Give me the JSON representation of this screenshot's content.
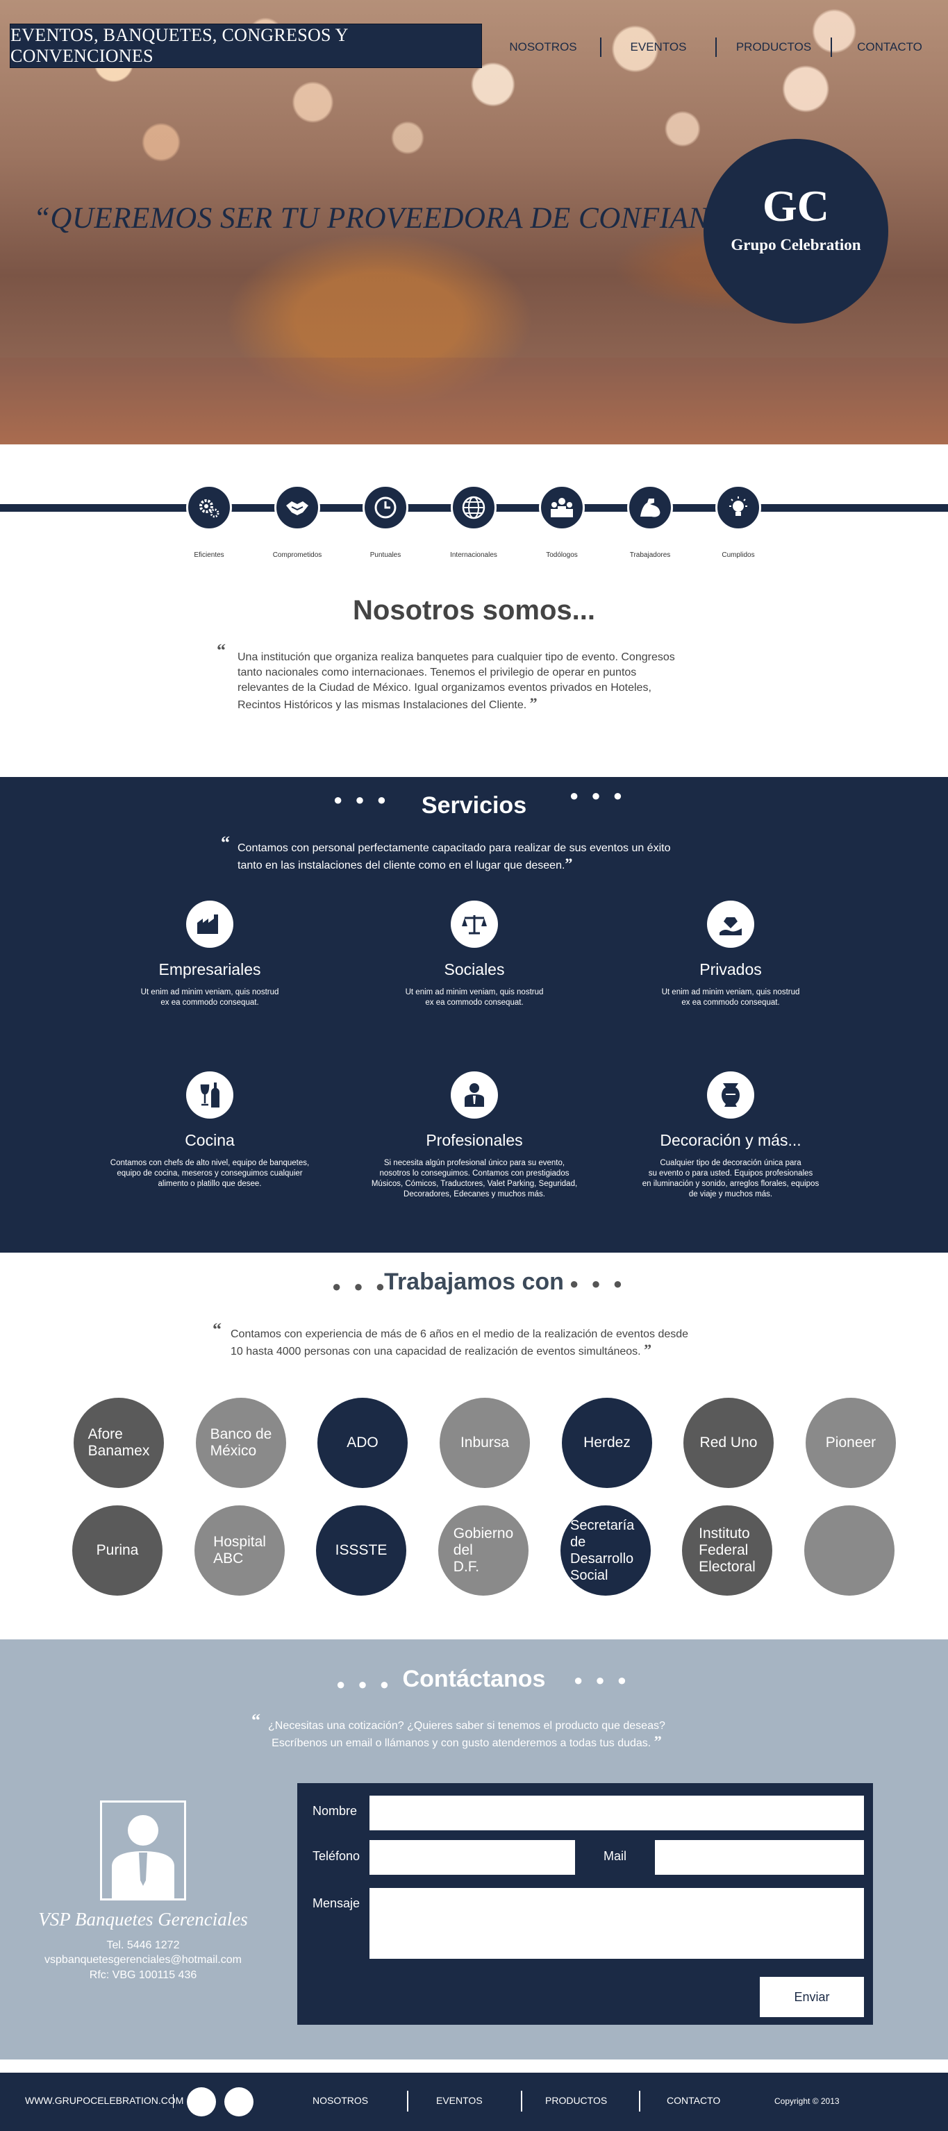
{
  "header": {
    "title": "EVENTOS, BANQUETES, CONGRESOS Y CONVENCIONES",
    "nav": [
      "NOSOTROS",
      "EVENTOS",
      "PRODUCTOS",
      "CONTACTO"
    ],
    "slogan": "“QUEREMOS SER TU PROVEEDORA DE CONFIANZA.”",
    "logo_letters": "GC",
    "logo_name": "Grupo Celebration"
  },
  "values": [
    {
      "label": "Eficientes",
      "icon": "gears-icon"
    },
    {
      "label": "Comprometidos",
      "icon": "handshake-icon"
    },
    {
      "label": "Puntuales",
      "icon": "clock-icon"
    },
    {
      "label": "Internacionales",
      "icon": "globe-icon"
    },
    {
      "label": "Todólogos",
      "icon": "team-icon"
    },
    {
      "label": "Trabajadores",
      "icon": "muscle-arm-icon"
    },
    {
      "label": "Cumplidos",
      "icon": "lightbulb-icon"
    }
  ],
  "nosotros": {
    "title": "Nosotros somos...",
    "lines": [
      "Una institución que organiza realiza banquetes para cualquier tipo de evento. Congresos",
      "tanto nacionales como internacionaes. Tenemos el privilegio de operar en puntos",
      "relevantes de la Ciudad de México. Igual organizamos eventos privados en Hoteles,",
      "Recintos Históricos y las mismas Instalaciones del Cliente."
    ]
  },
  "servicios": {
    "title": "Servicios",
    "intro": [
      "Contamos con personal perfectamente capacitado para realizar de sus eventos un éxito",
      "tanto en las instalaciones del cliente como en el lugar que deseen."
    ],
    "items": [
      {
        "title": "Empresariales",
        "icon": "factory-icon",
        "text": [
          "Ut enim ad minim veniam, quis nostrud",
          "ex ea commodo consequat."
        ]
      },
      {
        "title": "Sociales",
        "icon": "scales-icon",
        "text": [
          "Ut enim ad minim veniam, quis nostrud",
          "ex ea commodo consequat."
        ]
      },
      {
        "title": "Privados",
        "icon": "diamond-hand-icon",
        "text": [
          "Ut enim ad minim veniam, quis nostrud",
          "ex ea commodo consequat."
        ]
      },
      {
        "title": "Cocina",
        "icon": "wine-bottle-icon",
        "text": [
          "Contamos con chefs de alto nivel, equipo de banquetes,",
          "equipo de cocina, meseros y conseguimos cualquier",
          "alimento o platillo que desee."
        ]
      },
      {
        "title": "Profesionales",
        "icon": "professional-icon",
        "text": [
          "Si necesita algún profesional único para su evento,",
          "nosotros lo conseguimos. Contamos con prestigiados",
          "Músicos, Cómicos, Traductores, Valet Parking, Seguridad,",
          "Decoradores, Edecanes y muchos más."
        ]
      },
      {
        "title": "Decoración y más...",
        "icon": "vase-icon",
        "text": [
          "Cualquier tipo de decoración única para",
          "su evento o para usted. Equipos profesionales",
          "en iluminación y sonido, arreglos florales, equipos",
          "de viaje y muchos más."
        ]
      }
    ]
  },
  "partners": {
    "title": "Trabajamos con",
    "lines": [
      "Contamos con experiencia de más de 6 años en el medio de la realización de eventos desde",
      "10 hasta 4000 personas con una capacidad de realización de eventos simultáneos."
    ],
    "row1": [
      "Afore\nBanamex",
      "Banco de\nMéxico",
      "ADO",
      "Inbursa",
      "Herdez",
      "Red Uno",
      "Pioneer"
    ],
    "row2": [
      "Purina",
      "Hospital\nABC",
      "ISSSTE",
      "Gobierno\ndel\nD.F.",
      "Secretaría\nde Desarrollo\nSocial",
      "Instituto\nFederal\nElectoral",
      ""
    ]
  },
  "contacto": {
    "title": "Contáctanos",
    "lines": [
      "¿Necesitas una cotización? ¿Quieres saber si tenemos el producto que deseas?",
      "Escríbenos un email o llámanos y con gusto atenderemos a todas tus dudas."
    ],
    "company": "VSP Banquetes Gerenciales",
    "tel": "Tel. 5446 1272",
    "email": "vspbanquetesgerenciales@hotmail.com",
    "rfc": "Rfc: VBG 100115 436",
    "form": {
      "name_label": "Nombre",
      "phone_label": "Teléfono",
      "mail_label": "Mail",
      "message_label": "Mensaje",
      "submit_label": "Enviar"
    }
  },
  "footer": {
    "site": "WWW.GRUPOCELEBRATION.COM",
    "nav": [
      "NOSOTROS",
      "EVENTOS",
      "PRODUCTOS",
      "CONTACTO"
    ],
    "copyright": "Copyright © 2013"
  },
  "colors": {
    "navy": "#1b2a45",
    "contact_bg": "#a6b4c2",
    "partner_grey": "#8a8a8a",
    "partner_dark": "#5a5a5a"
  }
}
